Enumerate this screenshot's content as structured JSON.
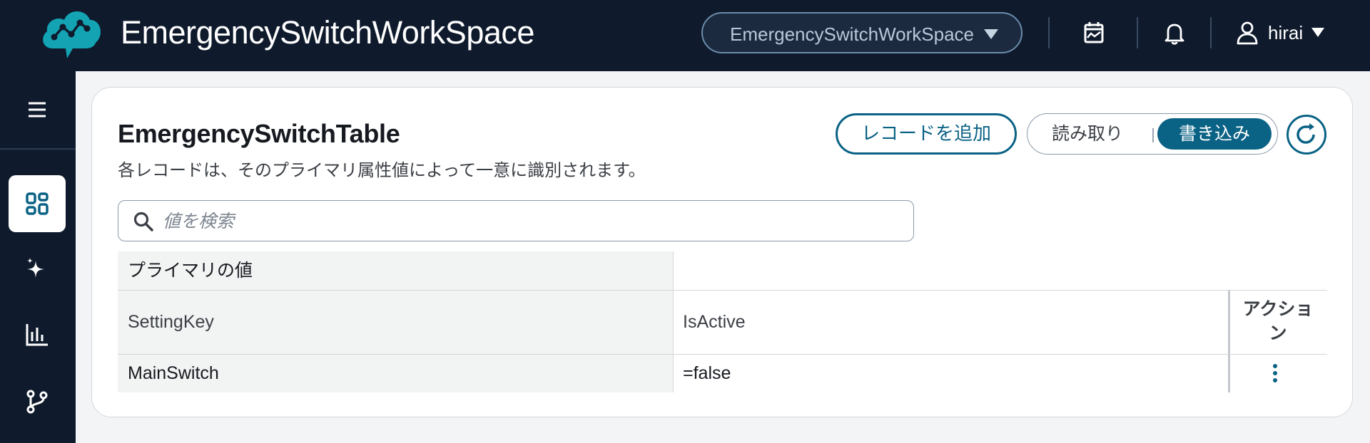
{
  "header": {
    "app_title": "EmergencySwitchWorkSpace",
    "workspace_select": "EmergencySwitchWorkSpace",
    "user_name": "hirai",
    "icons": [
      "logo-cloud-icon",
      "calendar-chart-icon",
      "bell-icon",
      "user-icon"
    ]
  },
  "sidebar": {
    "items": [
      {
        "icon": "menu-icon"
      },
      {
        "icon": "dashboard-grid-icon",
        "active": true
      },
      {
        "icon": "sparkle-icon"
      },
      {
        "icon": "bar-chart-icon"
      },
      {
        "icon": "branch-icon"
      }
    ]
  },
  "card": {
    "title": "EmergencySwitchTable",
    "description": "各レコードは、そのプライマリ属性値によって一意に識別されます。",
    "add_record_label": "レコードを追加",
    "mode_read_label": "読み取り",
    "mode_write_label": "書き込み",
    "mode_selected": "書き込み",
    "search_placeholder": "値を検索"
  },
  "table": {
    "group_header": "プライマリの値",
    "columns": [
      "SettingKey",
      "IsActive",
      "アクション"
    ],
    "rows": [
      {
        "SettingKey": "MainSwitch",
        "IsActive": "=false"
      }
    ]
  },
  "colors": {
    "topbar_bg": "#0f1b2d",
    "accent": "#0a6285",
    "logo": "#13a3b3"
  }
}
